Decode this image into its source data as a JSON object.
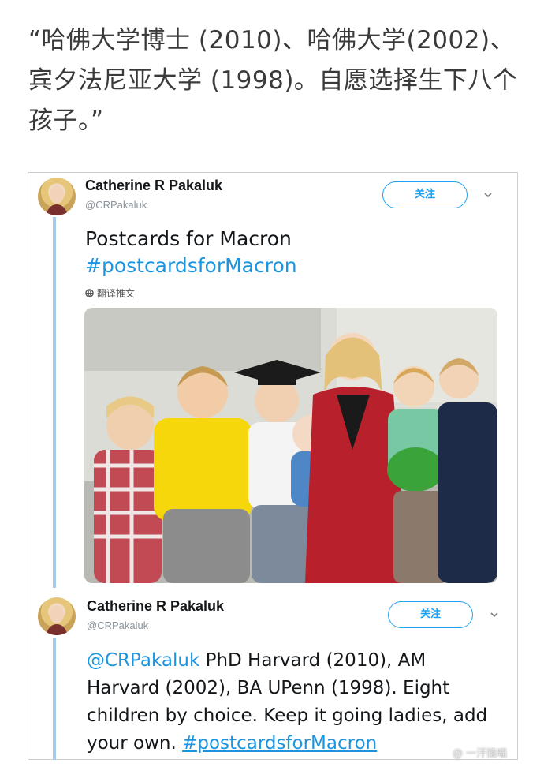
{
  "caption": "“哈佛大学博士 (2010)、哈佛大学(2002)、宾夕法尼亚大学 (1998)。自愿选择生下八个孩子。”",
  "tweet1": {
    "name": "Catherine R Pakaluk",
    "handle": "@CRPakaluk",
    "follow": "关注",
    "line1": "Postcards for Macron",
    "hashtag": "#postcardsforMacron",
    "translate": "翻译推文"
  },
  "tweet2": {
    "name": "Catherine R Pakaluk",
    "handle": "@CRPakaluk",
    "follow": "关注",
    "mention": "@CRPakaluk",
    "body": " PhD Harvard (2010), AM Harvard (2002), BA UPenn (1998). Eight children by choice. Keep it going ladies, add your own. ",
    "hashtag": "#postcardsforMacron"
  },
  "watermark": "@ 一汗猿喵"
}
